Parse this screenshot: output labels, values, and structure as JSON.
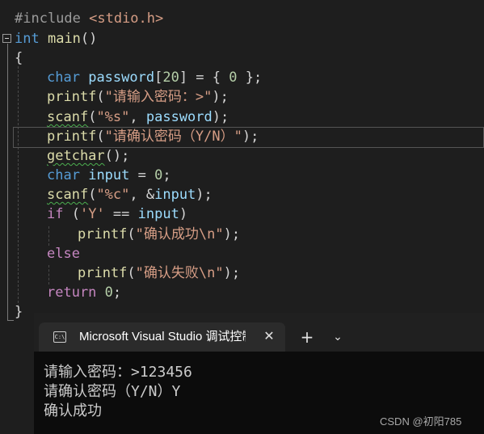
{
  "editor": {
    "lines": [
      {
        "tokens": [
          {
            "t": "#include ",
            "c": "pp"
          },
          {
            "t": "<stdio.h>",
            "c": "inc"
          }
        ]
      },
      {
        "tokens": [
          {
            "t": "int",
            "c": "kw"
          },
          {
            "t": " ",
            "c": ""
          },
          {
            "t": "main",
            "c": "fn"
          },
          {
            "t": "()",
            "c": ""
          }
        ]
      },
      {
        "tokens": [
          {
            "t": "{",
            "c": ""
          }
        ]
      },
      {
        "tokens": [
          {
            "t": "char",
            "c": "kw"
          },
          {
            "t": " ",
            "c": ""
          },
          {
            "t": "password",
            "c": "id"
          },
          {
            "t": "[",
            "c": ""
          },
          {
            "t": "20",
            "c": "num"
          },
          {
            "t": "] = { ",
            "c": ""
          },
          {
            "t": "0",
            "c": "num"
          },
          {
            "t": " };",
            "c": ""
          }
        ]
      },
      {
        "tokens": [
          {
            "t": "printf",
            "c": "fn"
          },
          {
            "t": "(",
            "c": ""
          },
          {
            "t": "\"请输入密码：>\"",
            "c": "str"
          },
          {
            "t": ");",
            "c": ""
          }
        ]
      },
      {
        "tokens": [
          {
            "t": "scanf",
            "c": "fn sq"
          },
          {
            "t": "(",
            "c": ""
          },
          {
            "t": "\"%s\"",
            "c": "str"
          },
          {
            "t": ", ",
            "c": ""
          },
          {
            "t": "password",
            "c": "id"
          },
          {
            "t": ");",
            "c": ""
          }
        ]
      },
      {
        "tokens": [
          {
            "t": "printf",
            "c": "fn"
          },
          {
            "t": "(",
            "c": ""
          },
          {
            "t": "\"请确认密码（Y/N）\"",
            "c": "str"
          },
          {
            "t": ");",
            "c": ""
          }
        ]
      },
      {
        "tokens": [
          {
            "t": "getchar",
            "c": "fn sq"
          },
          {
            "t": "();",
            "c": ""
          }
        ]
      },
      {
        "tokens": [
          {
            "t": "char",
            "c": "kw"
          },
          {
            "t": " ",
            "c": ""
          },
          {
            "t": "input",
            "c": "id"
          },
          {
            "t": " = ",
            "c": ""
          },
          {
            "t": "0",
            "c": "num"
          },
          {
            "t": ";",
            "c": ""
          }
        ]
      },
      {
        "tokens": [
          {
            "t": "scanf",
            "c": "fn sq"
          },
          {
            "t": "(",
            "c": ""
          },
          {
            "t": "\"%c\"",
            "c": "str"
          },
          {
            "t": ", &",
            "c": ""
          },
          {
            "t": "input",
            "c": "id"
          },
          {
            "t": ");",
            "c": ""
          }
        ]
      },
      {
        "tokens": [
          {
            "t": "if",
            "c": "ctl"
          },
          {
            "t": " (",
            "c": ""
          },
          {
            "t": "'Y'",
            "c": "str"
          },
          {
            "t": " == ",
            "c": ""
          },
          {
            "t": "input",
            "c": "id"
          },
          {
            "t": ")",
            "c": ""
          }
        ]
      },
      {
        "tokens": [
          {
            "t": "printf",
            "c": "fn"
          },
          {
            "t": "(",
            "c": ""
          },
          {
            "t": "\"确认成功\\n\"",
            "c": "str"
          },
          {
            "t": ");",
            "c": ""
          }
        ]
      },
      {
        "tokens": [
          {
            "t": "else",
            "c": "ctl"
          }
        ]
      },
      {
        "tokens": [
          {
            "t": "printf",
            "c": "fn"
          },
          {
            "t": "(",
            "c": ""
          },
          {
            "t": "\"确认失败\\n\"",
            "c": "str"
          },
          {
            "t": ");",
            "c": ""
          }
        ]
      },
      {
        "tokens": [
          {
            "t": "return",
            "c": "ctl"
          },
          {
            "t": " ",
            "c": ""
          },
          {
            "t": "0",
            "c": "num"
          },
          {
            "t": ";",
            "c": ""
          }
        ]
      },
      {
        "tokens": [
          {
            "t": "}",
            "c": ""
          }
        ]
      }
    ]
  },
  "terminal": {
    "tab_title": "Microsoft Visual Studio 调试控制台",
    "tab_icon_text": "C:\\",
    "close_glyph": "✕",
    "new_tab_glyph": "+",
    "dropdown_glyph": "⌄",
    "output": [
      "请输入密码：>123456",
      "请确认密码（Y/N）Y",
      "确认成功"
    ]
  },
  "watermark": "CSDN @初阳785"
}
